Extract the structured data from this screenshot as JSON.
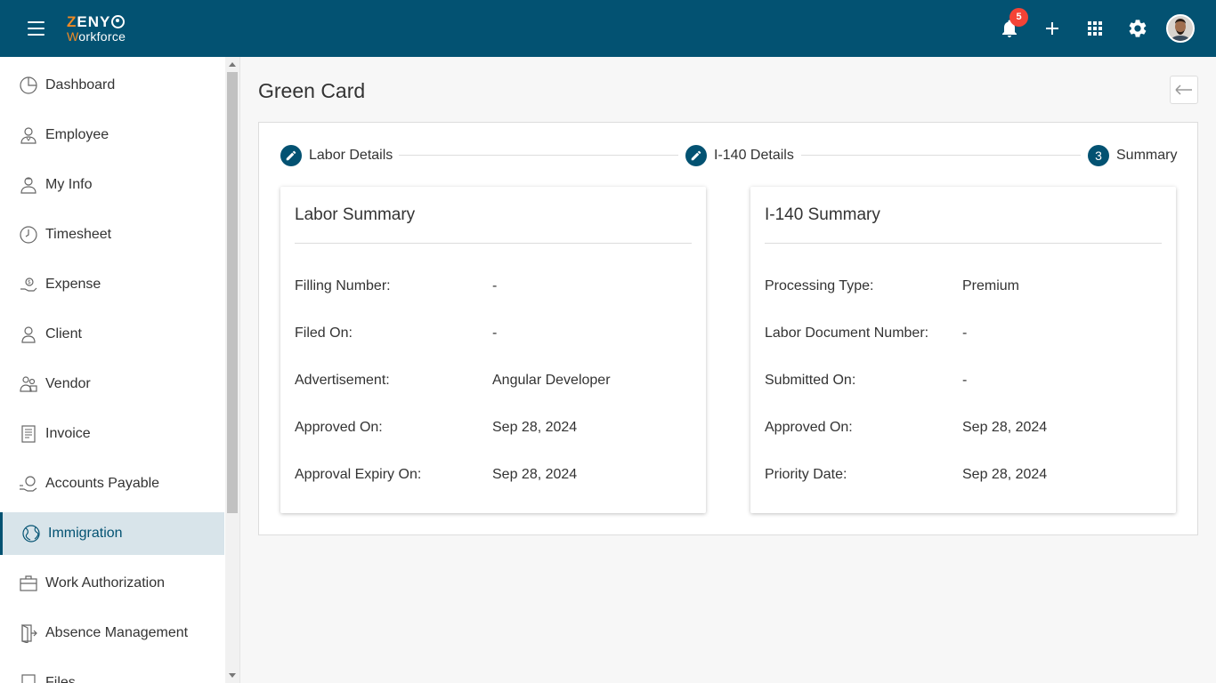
{
  "header": {
    "logo_line1_first": "Z",
    "logo_line1_rest": "ENY",
    "logo_line2_first": "W",
    "logo_line2_rest": "orkforce",
    "notification_count": "5",
    "brand_color": "#035272",
    "badge_color": "#f44336"
  },
  "sidebar": {
    "items": [
      {
        "label": "Dashboard",
        "icon": "pie-chart-icon"
      },
      {
        "label": "Employee",
        "icon": "employee-icon"
      },
      {
        "label": "My Info",
        "icon": "my-info-icon"
      },
      {
        "label": "Timesheet",
        "icon": "clock-icon"
      },
      {
        "label": "Expense",
        "icon": "expense-icon"
      },
      {
        "label": "Client",
        "icon": "user-icon"
      },
      {
        "label": "Vendor",
        "icon": "vendor-icon"
      },
      {
        "label": "Invoice",
        "icon": "invoice-icon"
      },
      {
        "label": "Accounts Payable",
        "icon": "payable-icon"
      },
      {
        "label": "Immigration",
        "icon": "globe-icon",
        "active": true
      },
      {
        "label": "Work Authorization",
        "icon": "briefcase-icon"
      },
      {
        "label": "Absence Management",
        "icon": "exit-door-icon"
      },
      {
        "label": "Files",
        "icon": "file-icon"
      }
    ]
  },
  "main": {
    "title": "Green Card",
    "steps": [
      {
        "label": "Labor Details",
        "state": "completed"
      },
      {
        "label": "I-140 Details",
        "state": "completed"
      },
      {
        "label": "Summary",
        "state": "current",
        "number": "3"
      }
    ],
    "labor_summary": {
      "title": "Labor Summary",
      "rows": [
        {
          "key": "Filling Number:",
          "value": "-"
        },
        {
          "key": "Filed On:",
          "value": "-"
        },
        {
          "key": "Advertisement:",
          "value": "Angular Developer"
        },
        {
          "key": "Approved On:",
          "value": "Sep 28, 2024"
        },
        {
          "key": "Approval Expiry On:",
          "value": "Sep 28, 2024"
        }
      ]
    },
    "i140_summary": {
      "title": "I-140 Summary",
      "rows": [
        {
          "key": "Processing Type:",
          "value": "Premium"
        },
        {
          "key": "Labor Document Number:",
          "value": "-"
        },
        {
          "key": "Submitted On:",
          "value": "-"
        },
        {
          "key": "Approved On:",
          "value": "Sep 28, 2024"
        },
        {
          "key": "Priority Date:",
          "value": "Sep 28, 2024"
        }
      ]
    }
  }
}
